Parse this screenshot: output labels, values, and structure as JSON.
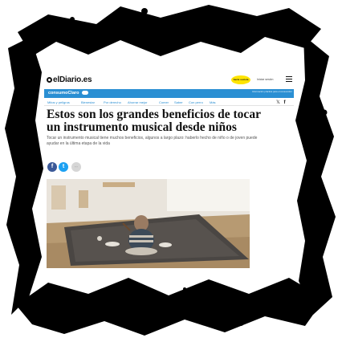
{
  "header": {
    "logo": "elDiario.es",
    "subscribe_label": "hazte socio/a",
    "login_label": "Iniciar sesión",
    "menu_icon": "hamburger-icon"
  },
  "section": {
    "title": "consumoClaro",
    "note": "Información práctica para el consumidor"
  },
  "nav": {
    "items": [
      "Mitos y peligros",
      "Bienestar",
      "Por derecho",
      "Ahorrar mejor",
      "Comer",
      "Saber",
      "Con perro",
      "Más"
    ]
  },
  "social_top": {
    "twitter": "𝕏",
    "facebook": "f"
  },
  "article": {
    "headline": "Estos son los grandes beneficios de tocar un instrumento musical desde niños",
    "deck": "Tocar un instrumento musical tiene muchos beneficios, algunos a largo plazo: haberlo hecho de niño o de joven puede ayudar en la última etapa de la vida"
  },
  "share": {
    "facebook": "f",
    "twitter": "t",
    "more": "···"
  },
  "colors": {
    "brand_blue": "#2a8fd3",
    "subscribe_yellow": "#ffe400",
    "facebook_blue": "#3b5998",
    "twitter_blue": "#1da1f2"
  }
}
